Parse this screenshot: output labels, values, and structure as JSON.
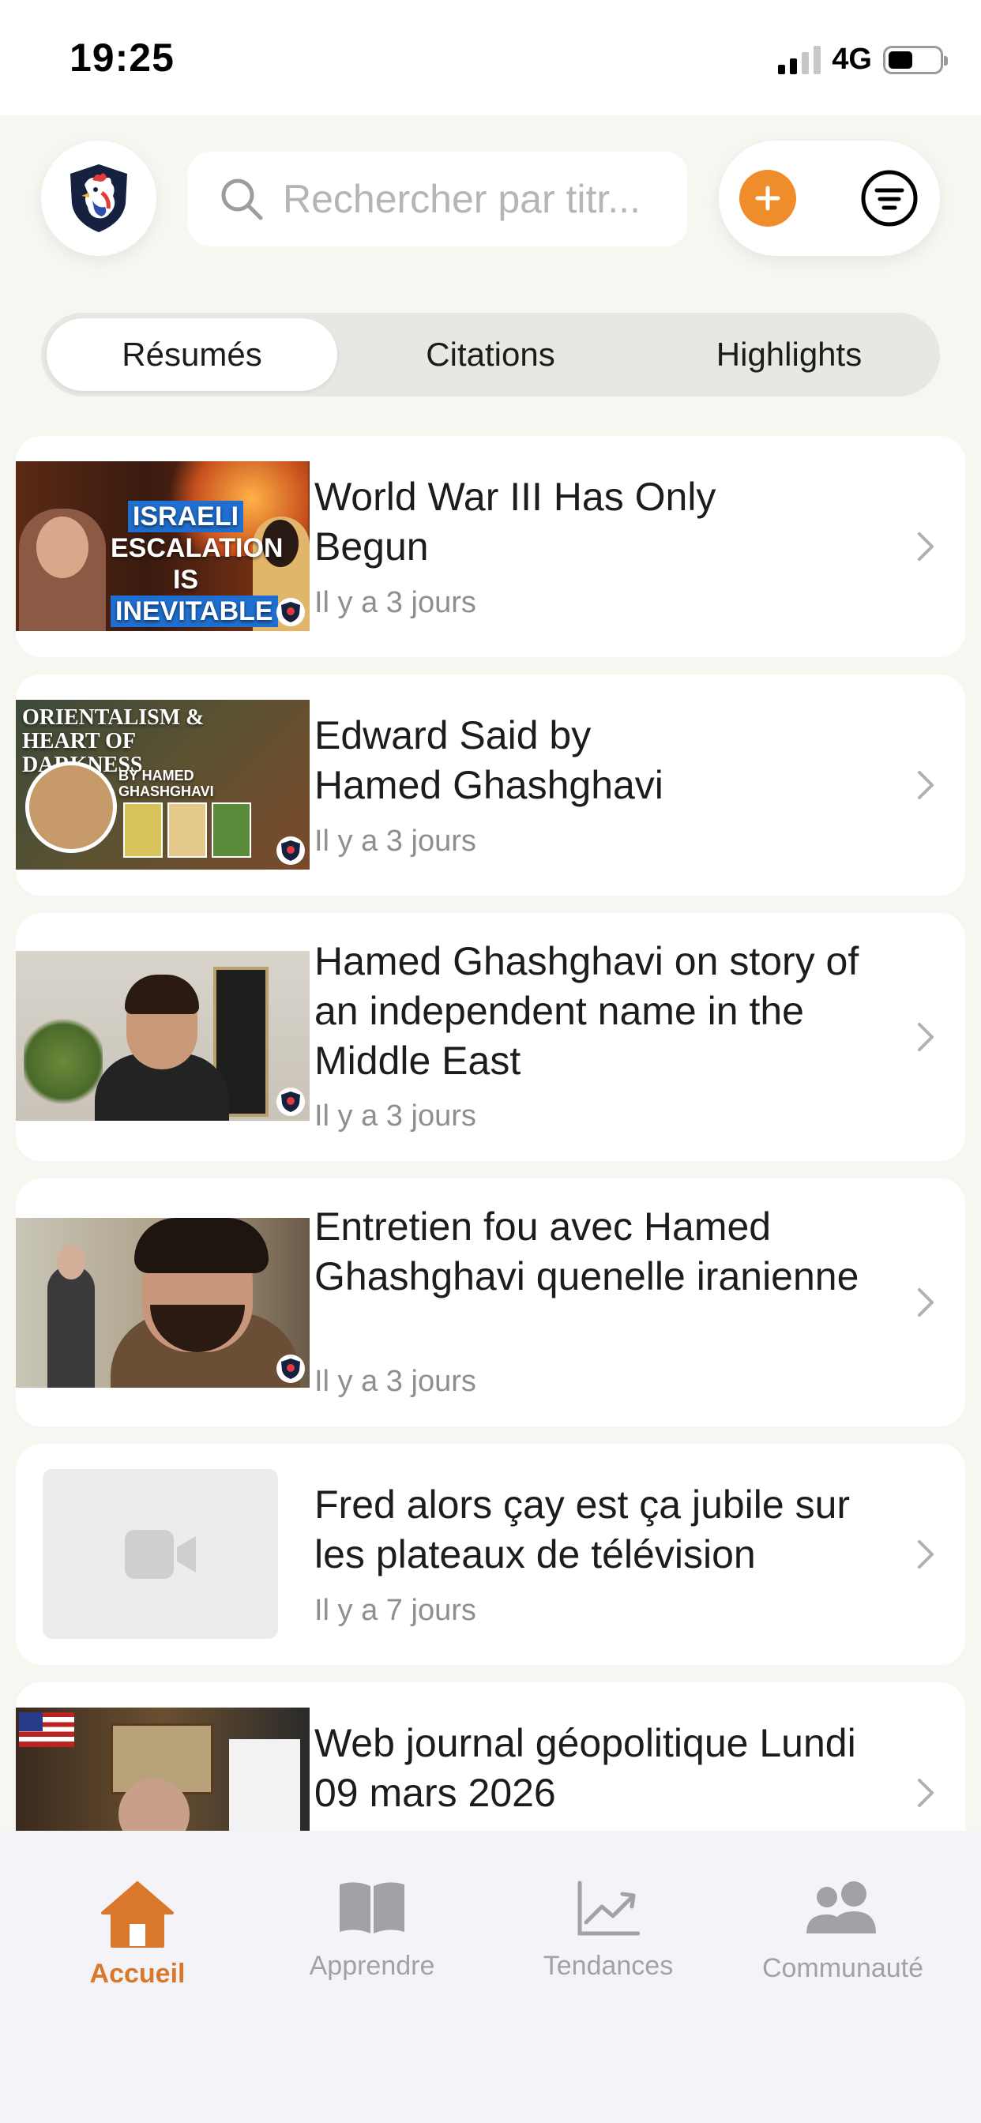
{
  "status_bar": {
    "time": "19:25",
    "network": "4G"
  },
  "header": {
    "logo_icon": "rooster-logo-icon",
    "search": {
      "placeholder": "Rechercher par titr..."
    },
    "add_icon": "plus-icon",
    "filter_icon": "filter-icon"
  },
  "segments": {
    "items": [
      {
        "label": "Résumés",
        "active": true
      },
      {
        "label": "Citations",
        "active": false
      },
      {
        "label": "Highlights",
        "active": false
      }
    ]
  },
  "list": {
    "items": [
      {
        "title": "World War III Has Only Begun",
        "time": "Il y a 3 jours",
        "thumb_text": [
          "ISRAELI",
          "ESCALATION IS",
          "INEVITABLE"
        ]
      },
      {
        "title": "Edward Said by Hamed Ghashghavi",
        "time": "Il y a 3 jours",
        "thumb_text": [
          "ORIENTALISM &",
          "HEART OF DARKNESS",
          "BY HAMED",
          "GHASHGHAVI"
        ]
      },
      {
        "title": "Hamed Ghashghavi on story of an independent name in the Middle East",
        "time": "Il y a 3 jours"
      },
      {
        "title": "Entretien fou avec Hamed Ghashghavi quenelle iranienne",
        "time": "Il y a 3 jours"
      },
      {
        "title": "Fred alors çay est ça jubile sur les plateaux de télévision",
        "time": "Il y a 7 jours",
        "placeholder_icon": "video-camera-icon"
      },
      {
        "title": "Web journal géopolitique Lundi 09 mars 2026",
        "time": ""
      }
    ]
  },
  "tab_bar": {
    "tabs": [
      {
        "label": "Accueil",
        "icon": "home-icon",
        "active": true
      },
      {
        "label": "Apprendre",
        "icon": "book-icon",
        "active": false
      },
      {
        "label": "Tendances",
        "icon": "trend-chart-icon",
        "active": false
      },
      {
        "label": "Communauté",
        "icon": "people-icon",
        "active": false
      }
    ]
  },
  "colors": {
    "accent": "#ef8d2b",
    "active_tab": "#d9772a",
    "background": "#f7f6f1"
  }
}
